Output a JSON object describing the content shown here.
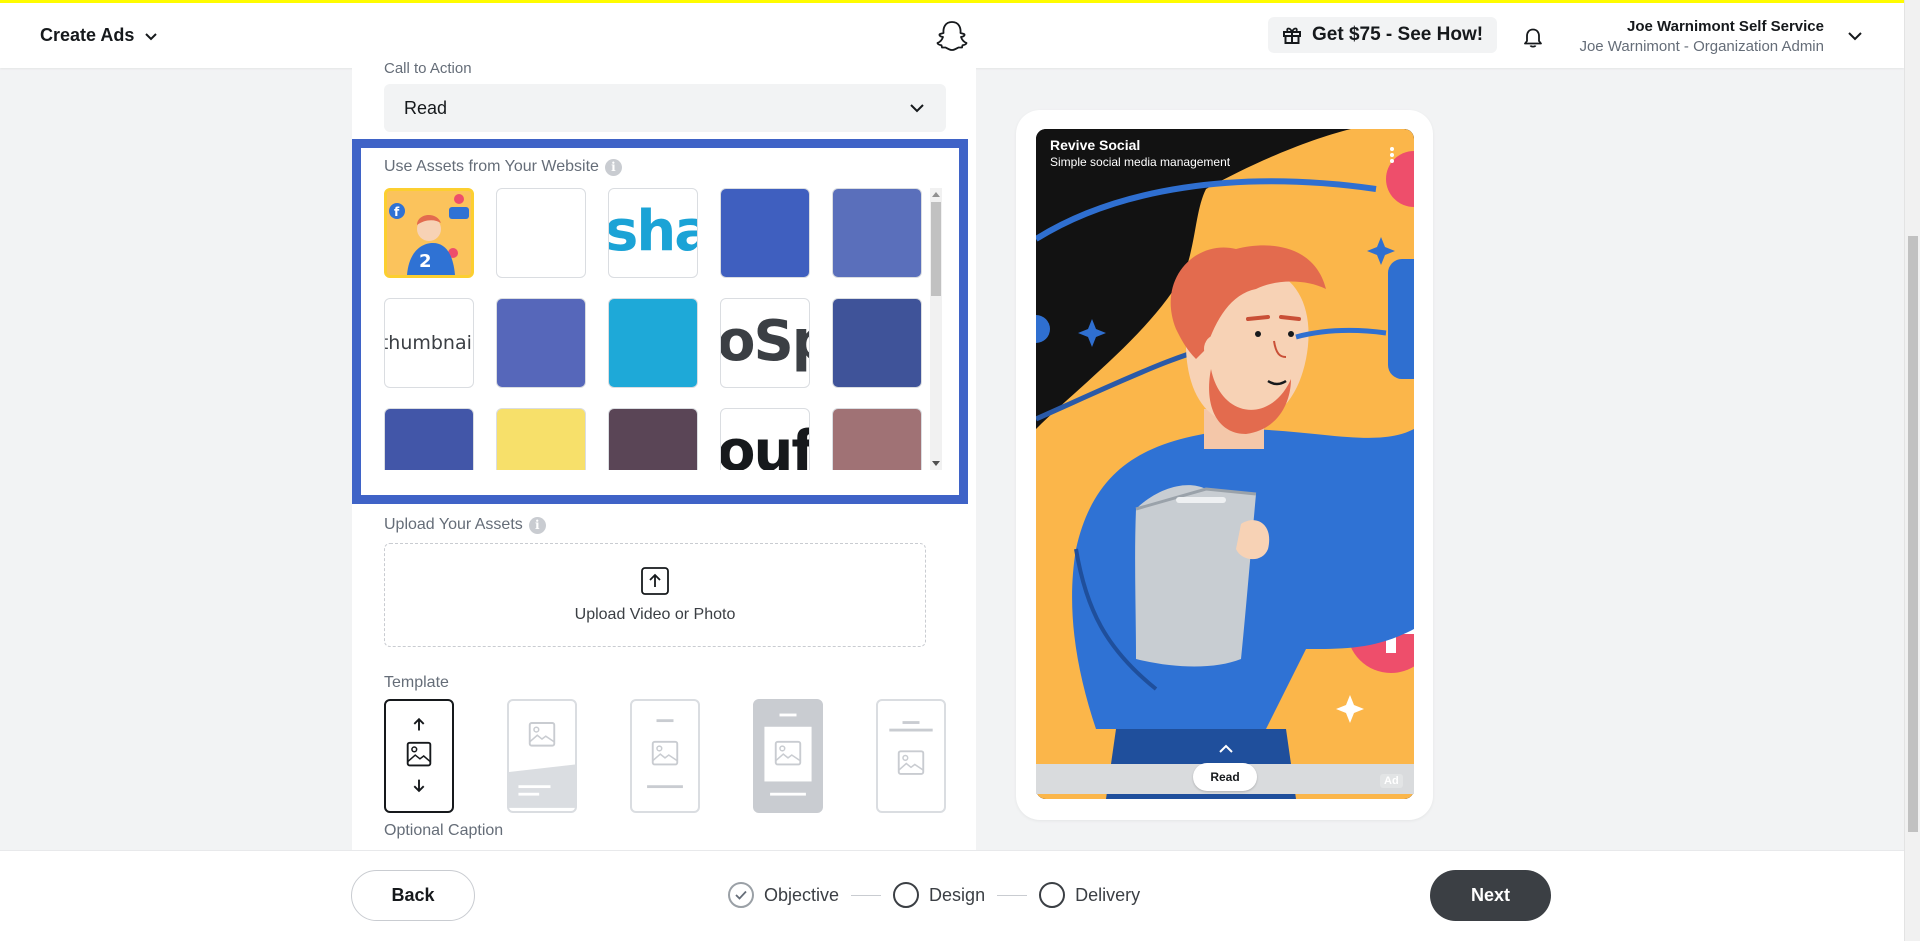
{
  "header": {
    "menu_label": "Create Ads",
    "promo_label": "Get $75 - See How!",
    "user_name": "Joe Warnimont Self Service",
    "user_role": "Joe Warnimont - Organization Admin"
  },
  "form": {
    "cta_label": "Call to Action",
    "cta_value": "Read",
    "assets_title": "Use Assets from Your Website",
    "info_glyph": "i",
    "tiles": [
      {
        "kind": "illustration",
        "selected": true
      },
      {
        "kind": "blank",
        "color": "#ffffff"
      },
      {
        "kind": "text",
        "text": "sha",
        "color": "#ffffff",
        "text_color": "#1ba3d6"
      },
      {
        "kind": "color",
        "color": "#3f5fbf"
      },
      {
        "kind": "color",
        "color": "#5a6fbb"
      },
      {
        "kind": "broken",
        "text": "thumbnail"
      },
      {
        "kind": "color",
        "color": "#5667ba"
      },
      {
        "kind": "color",
        "color": "#1ea9d8"
      },
      {
        "kind": "text",
        "text": "oSp",
        "color": "#ffffff",
        "text_color": "#3b3f44"
      },
      {
        "kind": "color",
        "color": "#3f5399"
      },
      {
        "kind": "color",
        "color": "#4256a8"
      },
      {
        "kind": "color",
        "color": "#f7e06a"
      },
      {
        "kind": "color",
        "color": "#5a4556"
      },
      {
        "kind": "text",
        "text": "ouf",
        "color": "#ffffff",
        "text_color": "#16191c"
      },
      {
        "kind": "color",
        "color": "#a07275"
      }
    ],
    "upload_title": "Upload Your Assets",
    "upload_button": "Upload Video or Photo",
    "template_title": "Template",
    "caption_title": "Optional Caption"
  },
  "preview": {
    "brand_name": "Revive Social",
    "headline": "Simple social media management",
    "cta": "Read",
    "ad_tag": "Ad"
  },
  "footer": {
    "back": "Back",
    "next": "Next",
    "steps": [
      "Objective",
      "Design",
      "Delivery"
    ]
  },
  "colors": {
    "accent_blue": "#3f63c7",
    "snap_yellow": "#fffc00",
    "dark_button": "#3b3f44"
  }
}
